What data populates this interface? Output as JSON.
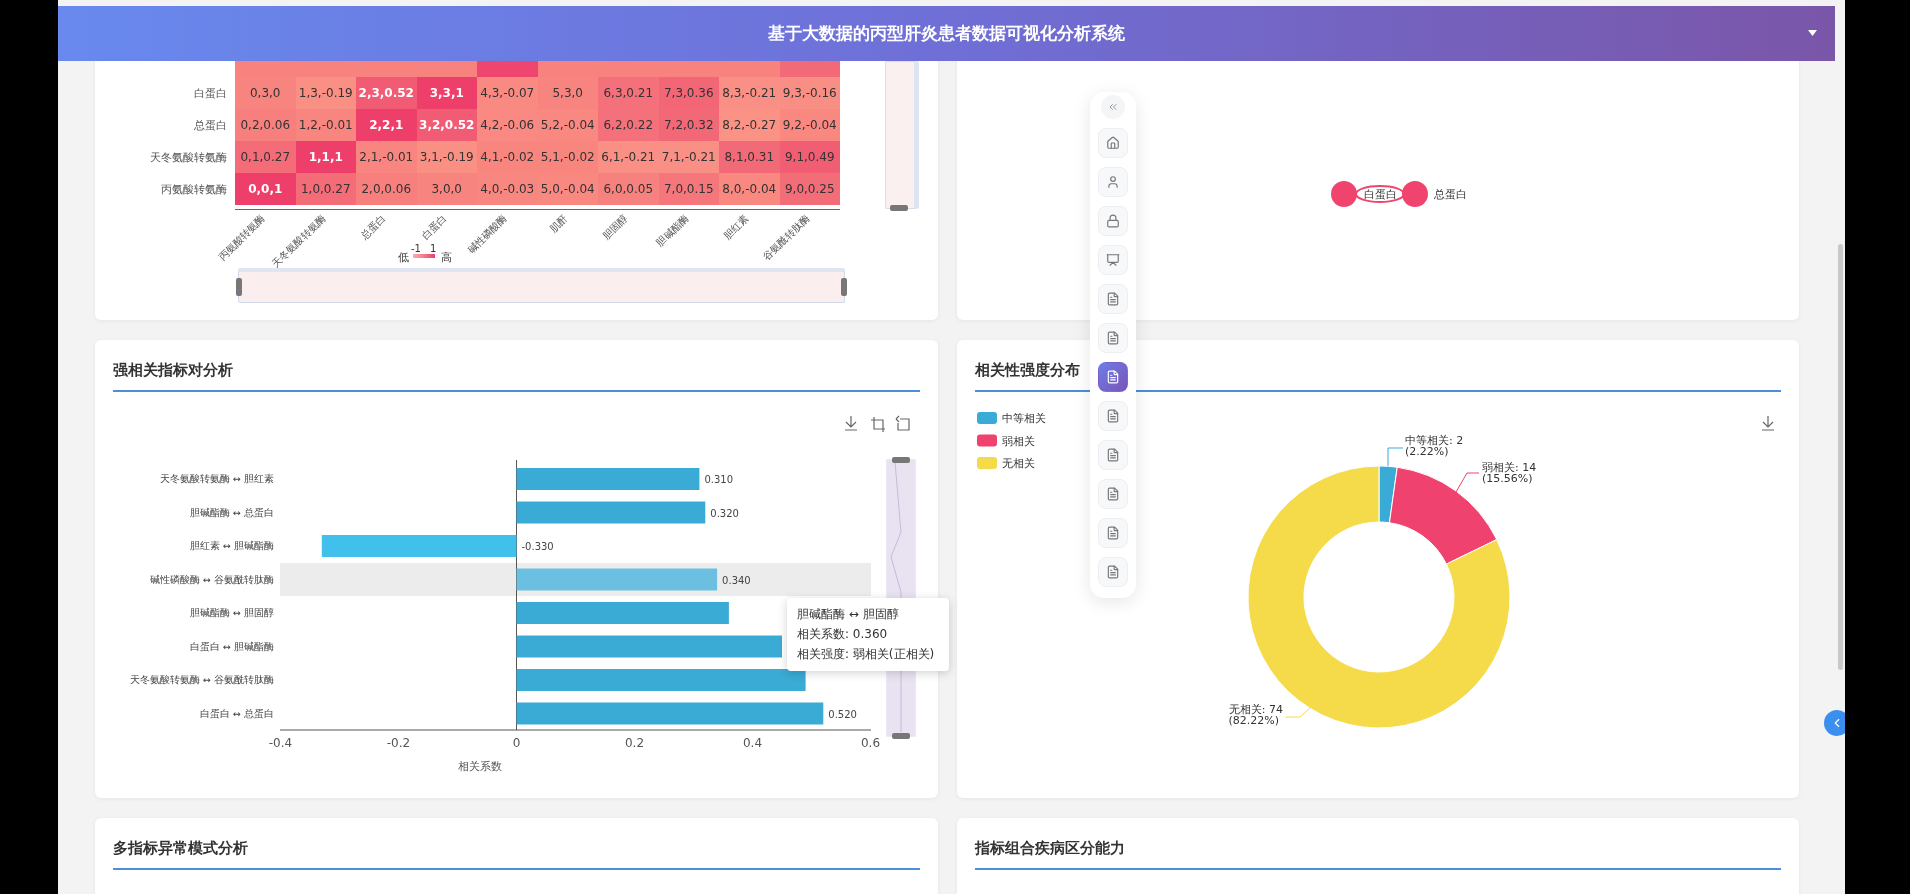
{
  "header": {
    "title": "基于大数据的丙型肝炎患者数据可视化分析系统"
  },
  "heatmap": {
    "partial_row": [
      {
        "color": "#f7827e"
      },
      {
        "color": "#f7827e"
      },
      {
        "color": "#f7827e"
      },
      {
        "color": "#f7827e"
      },
      {
        "color": "#ef4670"
      },
      {
        "color": "#f7827e"
      },
      {
        "color": "#f7827e"
      },
      {
        "color": "#f7827e"
      },
      {
        "color": "#f7827e"
      },
      {
        "color": "#f26a78"
      }
    ],
    "rows": [
      {
        "label": "白蛋白",
        "cells": [
          {
            "text": "0,3,0",
            "color": "#f8847f"
          },
          {
            "text": "1,3,-0.19",
            "color": "#fa8f84"
          },
          {
            "text": "2,3,0.52",
            "color": "#f15c74"
          },
          {
            "text": "3,3,1",
            "color": "#ee3f6b"
          },
          {
            "text": "4,3,-0.07",
            "color": "#f98a82"
          },
          {
            "text": "5,3,0",
            "color": "#f8847f"
          },
          {
            "text": "6,3,0.21",
            "color": "#f4707a"
          },
          {
            "text": "7,3,0.36",
            "color": "#f26676"
          },
          {
            "text": "8,3,-0.21",
            "color": "#fa9085"
          },
          {
            "text": "9,3,-0.16",
            "color": "#f98e84"
          }
        ]
      },
      {
        "label": "总蛋白",
        "cells": [
          {
            "text": "0,2,0.06",
            "color": "#f7807e"
          },
          {
            "text": "1,2,-0.01",
            "color": "#f8857f"
          },
          {
            "text": "2,2,1",
            "color": "#ee3f6b"
          },
          {
            "text": "3,2,0.52",
            "color": "#f15c74"
          },
          {
            "text": "4,2,-0.06",
            "color": "#f98982"
          },
          {
            "text": "5,2,-0.04",
            "color": "#f98881"
          },
          {
            "text": "6,2,0.22",
            "color": "#f4707a"
          },
          {
            "text": "7,2,0.32",
            "color": "#f26877"
          },
          {
            "text": "8,2,-0.27",
            "color": "#fa9386"
          },
          {
            "text": "9,2,-0.04",
            "color": "#f98881"
          }
        ]
      },
      {
        "label": "天冬氨酸转氨酶",
        "cells": [
          {
            "text": "0,1,0.27",
            "color": "#f36c78"
          },
          {
            "text": "1,1,1",
            "color": "#ee3f6b"
          },
          {
            "text": "2,1,-0.01",
            "color": "#f8857f"
          },
          {
            "text": "3,1,-0.19",
            "color": "#fa8f84"
          },
          {
            "text": "4,1,-0.02",
            "color": "#f8867f"
          },
          {
            "text": "5,1,-0.02",
            "color": "#f8867f"
          },
          {
            "text": "6,1,-0.21",
            "color": "#fa9085"
          },
          {
            "text": "7,1,-0.21",
            "color": "#fa9085"
          },
          {
            "text": "8,1,0.31",
            "color": "#f26977"
          },
          {
            "text": "9,1,0.49",
            "color": "#f15e74"
          }
        ]
      },
      {
        "label": "丙氨酸转氨酶",
        "cells": [
          {
            "text": "0,0,1",
            "color": "#ee3f6b"
          },
          {
            "text": "1,0,0.27",
            "color": "#f36c78"
          },
          {
            "text": "2,0,0.06",
            "color": "#f7807e"
          },
          {
            "text": "3,0,0",
            "color": "#f8847f"
          },
          {
            "text": "4,0,-0.03",
            "color": "#f98781"
          },
          {
            "text": "5,0,-0.04",
            "color": "#f98881"
          },
          {
            "text": "6,0,0.05",
            "color": "#f7817e"
          },
          {
            "text": "7,0,0.15",
            "color": "#f5777b"
          },
          {
            "text": "8,0,-0.04",
            "color": "#f98881"
          },
          {
            "text": "9,0,0.25",
            "color": "#f36d78"
          }
        ]
      }
    ],
    "v_slider": {
      "level": 1
    },
    "h_slider": {
      "level": 1
    },
    "x_labels": [
      "丙氨酸转氨酶",
      "天冬氨酸转氨酶",
      "总蛋白",
      "白蛋白",
      "碱性磷酸酶",
      "肌酐",
      "胆固醇",
      "胆碱酯酶",
      "胆红素",
      "谷氨酰转肽酶"
    ],
    "legend": {
      "low": "低",
      "min": "-1",
      "max": "1",
      "high": "高"
    }
  },
  "network": {
    "nodes": [
      {
        "label": "白蛋白"
      },
      {
        "label": "总蛋白"
      }
    ]
  },
  "nav_rail": {
    "items": [
      {
        "kind": "home",
        "selected": false
      },
      {
        "kind": "user",
        "selected": false
      },
      {
        "kind": "lock",
        "selected": false
      },
      {
        "kind": "board",
        "selected": false
      },
      {
        "kind": "doc",
        "selected": false
      },
      {
        "kind": "doc",
        "selected": false
      },
      {
        "kind": "doc",
        "selected": true
      },
      {
        "kind": "doc",
        "selected": false
      },
      {
        "kind": "doc",
        "selected": false
      },
      {
        "kind": "doc",
        "selected": false
      },
      {
        "kind": "doc",
        "selected": false
      },
      {
        "kind": "doc",
        "selected": false
      }
    ]
  },
  "bar_panel": {
    "title": "强相关指标对分析",
    "highlighted": [
      false,
      false,
      false,
      true,
      false,
      false,
      false,
      false
    ],
    "chart_data": {
      "type": "bar",
      "orientation": "horizontal",
      "xlabel": "相关系数",
      "categories": [
        "天冬氨酸转氨酶 ↔ 胆红素",
        "胆碱酯酶 ↔ 总蛋白",
        "胆红素 ↔ 胆碱酯酶",
        "碱性磷酸酶 ↔ 谷氨酰转肽酶",
        "胆碱酯酶 ↔ 胆固醇",
        "白蛋白 ↔ 胆碱酯酶",
        "天冬氨酸转氨酶 ↔ 谷氨酰转肽酶",
        "白蛋白 ↔ 总蛋白"
      ],
      "values": [
        0.31,
        0.32,
        -0.33,
        0.34,
        0.36,
        0.45,
        0.49,
        0.52
      ],
      "xlim": [
        -0.4,
        0.6
      ],
      "xticks": [
        -0.4,
        -0.2,
        0,
        0.2,
        0.4,
        0.6
      ],
      "value_labels": [
        "0.310",
        "0.320",
        "-0.330",
        "0.340",
        null,
        null,
        null,
        "0.520"
      ]
    },
    "slider": {
      "level": 1
    },
    "tooltip": {
      "title": "胆碱酯酶 ↔ 胆固醇",
      "lines": [
        "相关系数: 0.360",
        "相关强度: 弱相关(正相关)"
      ]
    }
  },
  "pie_panel": {
    "title": "相关性强度分布",
    "slices": [
      {
        "color": "#3aabd6"
      },
      {
        "color": "#f0426e"
      },
      {
        "color": "#f5db4a"
      }
    ],
    "chart_data": {
      "type": "donut",
      "categories": [
        "中等相关",
        "弱相关",
        "无相关"
      ],
      "values": [
        2,
        14,
        74
      ],
      "legend": true,
      "value_labels": [
        "中等相关: 2",
        "弱相关: 14",
        "无相关: 74"
      ]
    },
    "percents": [
      "(2.22%)",
      "(15.56%)",
      "(82.22%)"
    ]
  },
  "bottom_panels": [
    {
      "title": "多指标异常模式分析"
    },
    {
      "title": "指标组合疾病区分能力"
    }
  ]
}
